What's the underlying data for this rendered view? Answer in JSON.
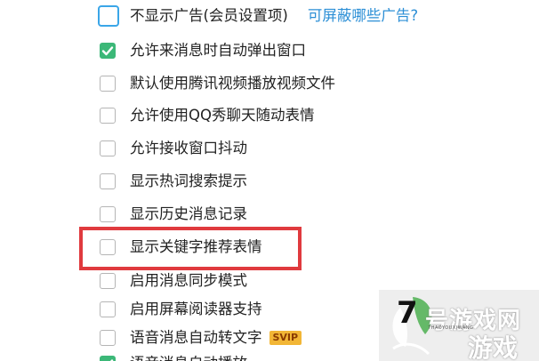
{
  "options": [
    {
      "label": "不显示广告(会员设置项)",
      "checked": false,
      "link": "可屏蔽哪些广告?"
    },
    {
      "label": "允许来消息时自动弹出窗口",
      "checked": true
    },
    {
      "label": "默认使用腾讯视频播放视频文件",
      "checked": false
    },
    {
      "label": "允许使用QQ秀聊天随动表情",
      "checked": false
    },
    {
      "label": "允许接收窗口抖动",
      "checked": false
    },
    {
      "label": "显示热词搜索提示",
      "checked": false
    },
    {
      "label": "显示历史消息记录",
      "checked": false
    },
    {
      "label": "显示关键字推荐表情",
      "checked": false
    },
    {
      "label": "启用消息同步模式",
      "checked": false
    },
    {
      "label": "启用屏幕阅读器支持",
      "checked": false
    },
    {
      "label": "语音消息自动转文字",
      "checked": false,
      "badge": "SVIP"
    },
    {
      "label": "语音消息自动播放",
      "checked": true
    }
  ],
  "watermark": {
    "number": "7",
    "title": "号游戏网",
    "subtitle": "7HAOYOUXIWANG",
    "tag": "游戏"
  },
  "colors": {
    "check_green": "#3cb878",
    "link_blue": "#2c8fd6",
    "highlight_red": "#e03a3e",
    "badge_yellow": "#f2b636"
  }
}
